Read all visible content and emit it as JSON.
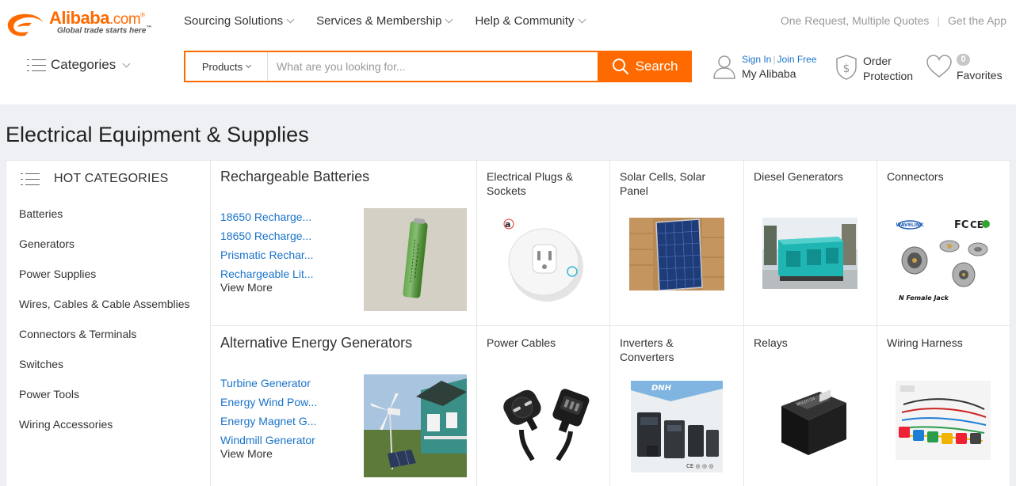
{
  "header": {
    "logo_text": "Alibaba",
    "logo_suffix": ".com",
    "logo_trademark": "®",
    "slogan": "Global trade starts here",
    "slogan_trademark": "™",
    "nav": [
      {
        "label": "Sourcing Solutions"
      },
      {
        "label": "Services & Membership"
      },
      {
        "label": "Help & Community"
      }
    ],
    "right_links": [
      "One Request, Multiple Quotes",
      "Get the App"
    ],
    "right_separator": "|",
    "categories_label": "Categories",
    "search": {
      "scope": "Products",
      "placeholder": "What are you looking for...",
      "button": "Search"
    },
    "account": {
      "sign_in": "Sign In",
      "link_separator": "|",
      "join": "Join Free",
      "title": "My Alibaba"
    },
    "order_protection": {
      "line1": "Order",
      "line2": "Protection"
    },
    "favorites": {
      "count": "0",
      "label": "Favorites"
    }
  },
  "page": {
    "title": "Electrical Equipment & Supplies"
  },
  "sidebar": {
    "heading": "HOT CATEGORIES",
    "items": [
      "Batteries",
      "Generators",
      "Power Supplies",
      "Wires, Cables & Cable Assemblies",
      "Connectors & Terminals",
      "Switches",
      "Power Tools",
      "Wiring Accessories"
    ]
  },
  "featured": [
    {
      "title": "Rechargeable Batteries",
      "links": [
        "18650 Recharge...",
        "18650 Recharge...",
        "Prismatic Rechar...",
        "Rechargeable Lit..."
      ],
      "more": "View More",
      "image_icon": "battery-icon"
    },
    {
      "title": "Alternative Energy Generators",
      "links": [
        "Turbine Generator",
        "Energy Wind Pow...",
        "Energy Magnet G...",
        "Windmill Generator"
      ],
      "more": "View More",
      "image_icon": "wind-turbine-icon"
    }
  ],
  "tiles": [
    {
      "title": "Electrical Plugs & Sockets",
      "image_icon": "smart-plug-icon"
    },
    {
      "title": "Solar Cells, Solar Panel",
      "image_icon": "solar-panel-icon"
    },
    {
      "title": "Diesel Generators",
      "image_icon": "diesel-generator-icon"
    },
    {
      "title": "Connectors",
      "image_icon": "connector-icon",
      "image_texts": [
        "FC",
        "CE",
        "N Female Jack"
      ]
    },
    {
      "title": "Power Cables",
      "image_icon": "power-cable-icon"
    },
    {
      "title": "Inverters & Converters",
      "image_icon": "inverter-icon"
    },
    {
      "title": "Relays",
      "image_icon": "relay-icon"
    },
    {
      "title": "Wiring Harness",
      "image_icon": "wiring-harness-icon"
    }
  ],
  "colors": {
    "brand": "#ff6a00",
    "link": "#1a73c9",
    "page_bg": "#eef0f4"
  }
}
